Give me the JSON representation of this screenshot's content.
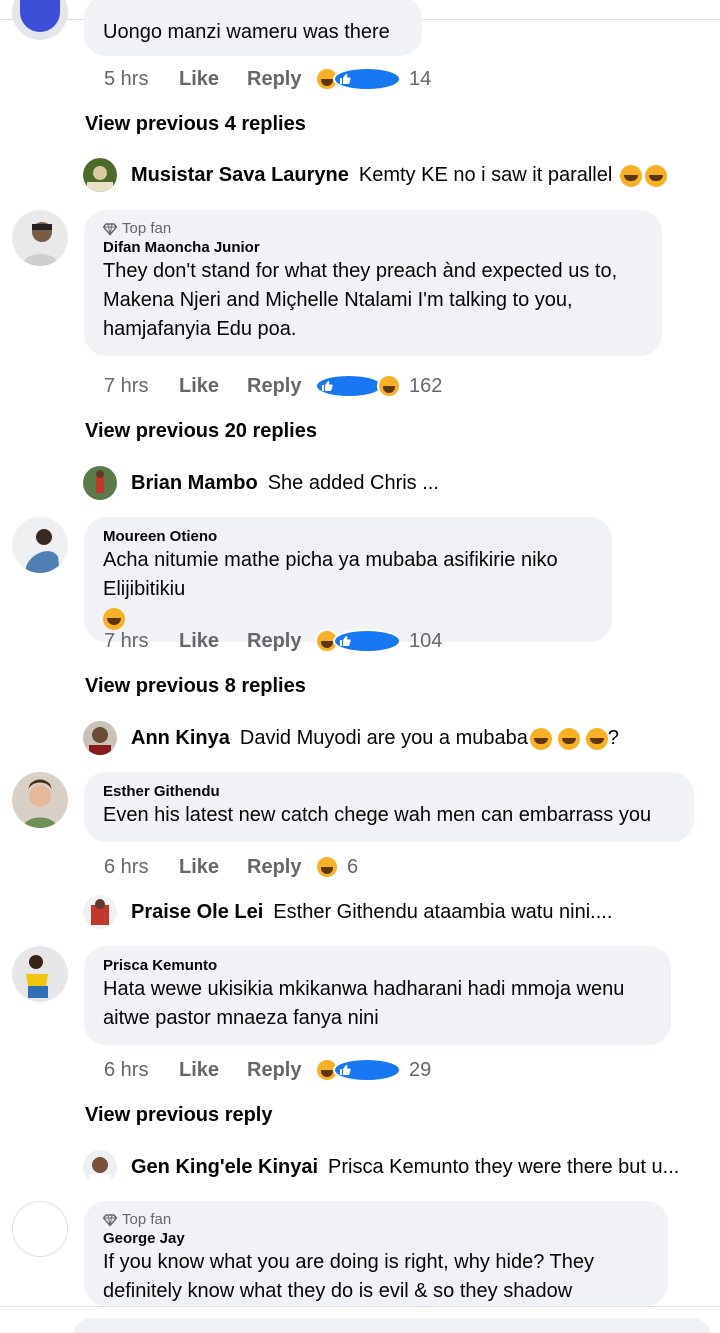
{
  "comments": [
    {
      "id": "c0",
      "text": "Uongo manzi wameru was there",
      "time": "5 hrs",
      "like": "Like",
      "reply": "Reply",
      "reactions": [
        "haha",
        "like"
      ],
      "count": "14",
      "view_previous": "View previous 4 replies",
      "latest_reply": {
        "name": "Musistar Sava Lauryne",
        "text": "Kemty KE no i saw it parallel"
      }
    },
    {
      "id": "c1",
      "badge": "Top fan",
      "name": "Difan Maoncha Junior",
      "text": "They don't stand for what they preach ànd expected us to, Makena Njeri and Miçhelle Ntalami I'm talking to you, hamjafanyia Edu poa.",
      "time": "7 hrs",
      "like": "Like",
      "reply": "Reply",
      "reactions": [
        "like",
        "haha"
      ],
      "count": "162",
      "view_previous": "View previous 20 replies",
      "latest_reply": {
        "name": "Brian Mambo",
        "text": "She added Chris ..."
      }
    },
    {
      "id": "c2",
      "name": "Moureen Otieno",
      "text": "Acha nitumie mathe picha ya   mubaba asifikirie niko Elijibitikiu",
      "time": "7 hrs",
      "like": "Like",
      "reply": "Reply",
      "reactions": [
        "haha",
        "like"
      ],
      "count": "104",
      "view_previous": "View previous 8 replies",
      "latest_reply": {
        "name": "Ann Kinya",
        "text": "David Muyodi are you a mubaba",
        "suffix": "?"
      }
    },
    {
      "id": "c3",
      "name": "Esther Githendu",
      "text": "Even his latest new catch chege wah men can embarrass you",
      "time": "6 hrs",
      "like": "Like",
      "reply": "Reply",
      "reactions": [
        "haha"
      ],
      "count": "6",
      "latest_reply": {
        "name": "Praise Ole Lei",
        "text": "Esther Githendu ataambia watu nini...."
      }
    },
    {
      "id": "c4",
      "name": "Prisca Kemunto",
      "text": "Hata wewe ukisikia mkikanwa hadharani hadi mmoja wenu aitwe pastor mnaeza fanya nini",
      "time": "6 hrs",
      "like": "Like",
      "reply": "Reply",
      "reactions": [
        "haha",
        "like"
      ],
      "count": "29",
      "view_previous": "View previous reply",
      "latest_reply": {
        "name": "Gen King'ele Kinyai",
        "text": "Prisca Kemunto they were there but u..."
      }
    },
    {
      "id": "c5",
      "badge": "Top fan",
      "name": "George Jay",
      "text": "If you know what you are doing is right, why hide? They definitely know what they do is evil & so they shadow"
    }
  ],
  "colors": {
    "bubble": "#f0f2f5",
    "secondary_text": "#65676b",
    "like_blue": "#1877f2",
    "haha_yellow": "#f7b125"
  }
}
